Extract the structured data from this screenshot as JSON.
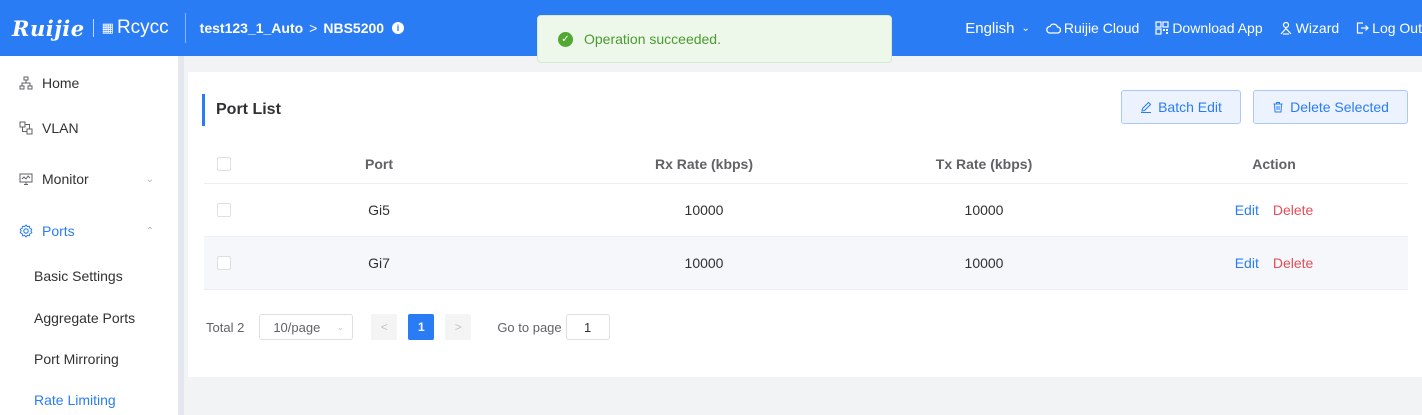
{
  "header": {
    "brand": "Ruijie",
    "subbrand": "Rcycc",
    "breadcrumb": {
      "project": "test123_1_Auto",
      "device": "NBS5200"
    },
    "language": "English",
    "links": {
      "cloud": "Ruijie Cloud",
      "download": "Download App",
      "wizard": "Wizard",
      "logout": "Log Out"
    }
  },
  "toast": {
    "message": "Operation succeeded."
  },
  "sidebar": {
    "items": [
      {
        "label": "Home",
        "icon": "network-icon"
      },
      {
        "label": "VLAN",
        "icon": "vlan-icon"
      },
      {
        "label": "Monitor",
        "icon": "monitor-icon"
      },
      {
        "label": "Ports",
        "icon": "gear-icon"
      }
    ],
    "subitems": [
      "Basic Settings",
      "Aggregate Ports",
      "Port Mirroring",
      "Rate Limiting"
    ]
  },
  "card": {
    "title": "Port List",
    "batch_edit_label": "Batch Edit",
    "delete_selected_label": "Delete Selected"
  },
  "table": {
    "headers": {
      "port": "Port",
      "rx": "Rx Rate (kbps)",
      "tx": "Tx Rate (kbps)",
      "action": "Action"
    },
    "rows": [
      {
        "port": "Gi5",
        "rx": "10000",
        "tx": "10000"
      },
      {
        "port": "Gi7",
        "rx": "10000",
        "tx": "10000"
      }
    ],
    "edit_label": "Edit",
    "delete_label": "Delete"
  },
  "pagination": {
    "total": "Total 2",
    "page_size": "10/page",
    "current_page": "1",
    "goto_label": "Go to page",
    "goto_value": "1"
  },
  "colors": {
    "primary": "#2a7cf5",
    "danger": "#e34d59",
    "success": "#52a833"
  }
}
